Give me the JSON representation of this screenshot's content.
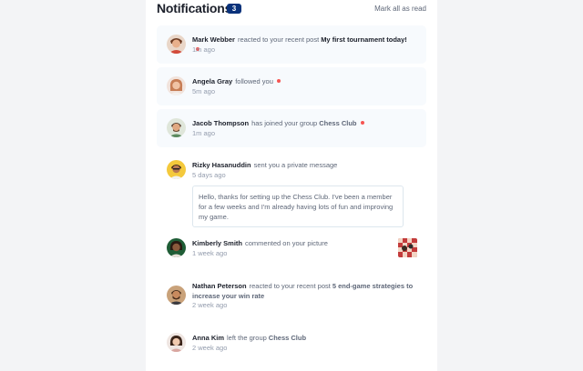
{
  "header": {
    "title": "Notifications",
    "unread_count": "3",
    "mark_all_label": "Mark all as read"
  },
  "notifications": [
    {
      "name": "Mark Webber",
      "action": "reacted to your recent post",
      "target": "My first tournament today!",
      "time": "1m ago",
      "unread": true,
      "avatar_icon": "avatar-mark-webber"
    },
    {
      "name": "Angela Gray",
      "action": "followed you",
      "time": "5m ago",
      "unread": true,
      "avatar_icon": "avatar-angela-gray"
    },
    {
      "name": "Jacob Thompson",
      "action": "has joined your group",
      "target": "Chess Club",
      "time": "1m ago",
      "unread": true,
      "avatar_icon": "avatar-jacob-thompson"
    },
    {
      "name": "Rizky Hasanuddin",
      "action": "sent you a private message",
      "time": "5 days ago",
      "message": "Hello, thanks for setting up the Chess Club. I've been a member for a few weeks and I'm already having lots of fun and improving my game.",
      "unread": false,
      "avatar_icon": "avatar-rizky-hasanuddin"
    },
    {
      "name": "Kimberly Smith",
      "action": "commented on your picture",
      "time": "1 week ago",
      "unread": false,
      "avatar_icon": "avatar-kimberly-smith",
      "picture_icon": "chess-picture-thumbnail"
    },
    {
      "name": "Nathan Peterson",
      "action": "reacted to your recent post",
      "target": "5 end-game strategies to increase your win rate",
      "time": "2 week ago",
      "unread": false,
      "avatar_icon": "avatar-nathan-peterson"
    },
    {
      "name": "Anna Kim",
      "action": "left the group",
      "target": "Chess Club",
      "time": "2 week ago",
      "unread": false,
      "avatar_icon": "avatar-anna-kim"
    }
  ],
  "colors": {
    "unread_background": "#f7fafd",
    "badge": "#0a327b",
    "dot": "#f65552",
    "dark_text": "#1c202b",
    "muted_text": "#5e6778",
    "time_text": "#939cad"
  }
}
